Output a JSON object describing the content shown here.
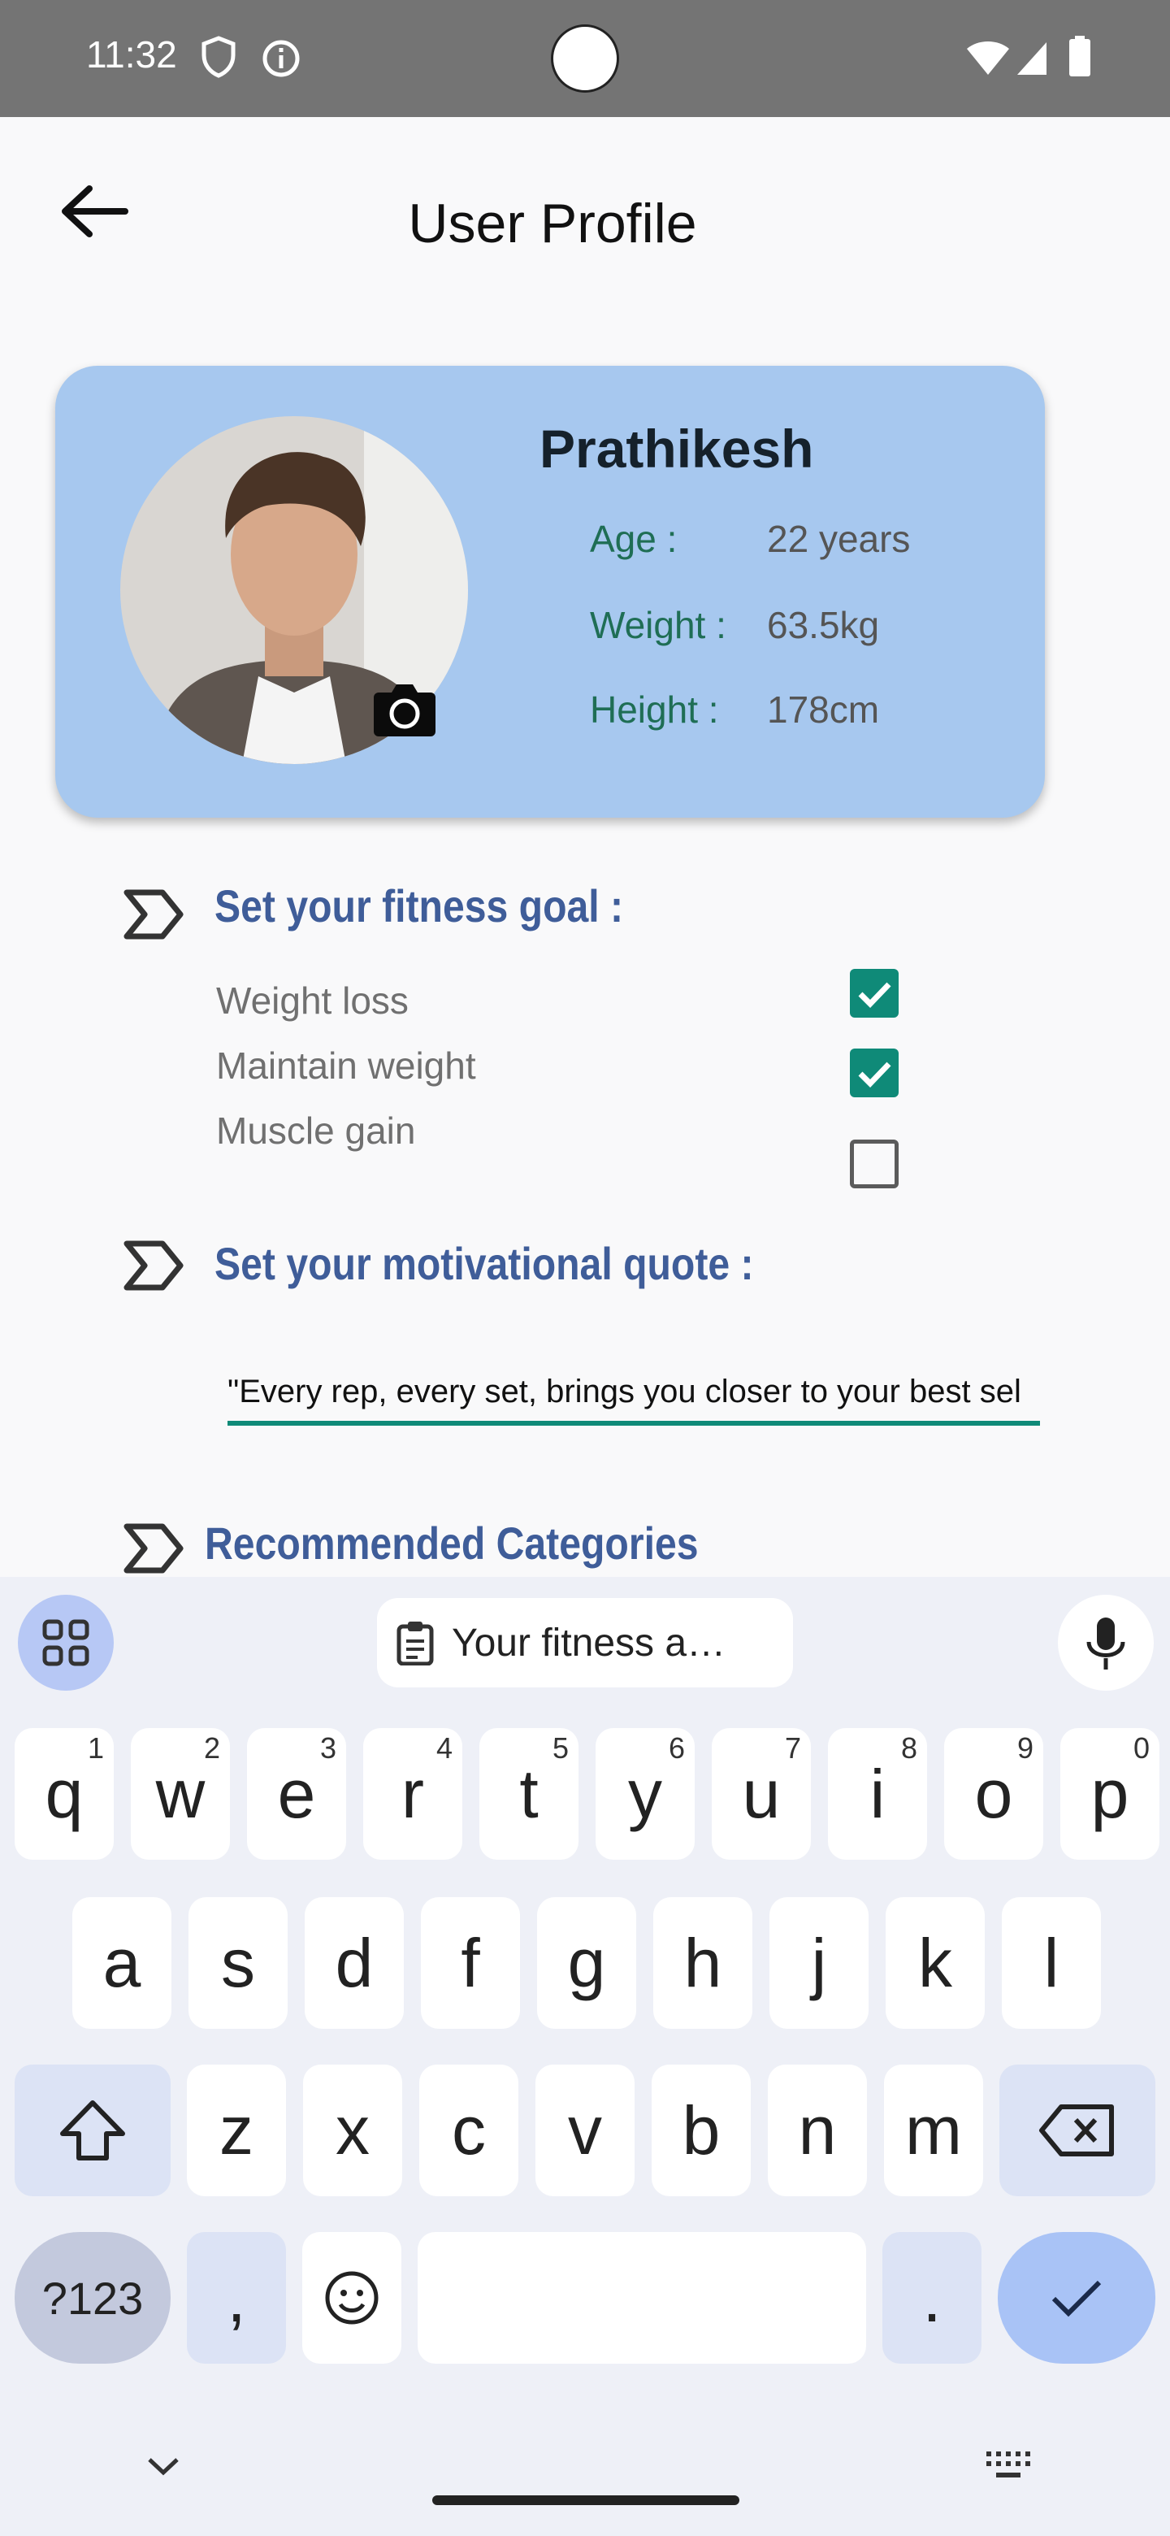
{
  "status_bar": {
    "time": "11:32"
  },
  "header": {
    "title": "User Profile"
  },
  "profile": {
    "name": "Prathikesh",
    "age_label": "Age :",
    "age_value": "22 years",
    "weight_label": "Weight :",
    "weight_value": "63.5kg",
    "height_label": "Height :",
    "height_value": "178cm"
  },
  "goal_section": {
    "title": "Set your fitness goal :",
    "options": [
      {
        "label": "Weight loss",
        "checked": true
      },
      {
        "label": "Maintain weight",
        "checked": true
      },
      {
        "label": "Muscle gain",
        "checked": false
      }
    ]
  },
  "quote_section": {
    "title": "Set your motivational quote :",
    "value": "\"Every rep, every set, brings you closer to your best sel"
  },
  "recommended": {
    "title": "Recommended Categories"
  },
  "keyboard": {
    "suggestion": "Your fitness a…",
    "row1": [
      "q",
      "w",
      "e",
      "r",
      "t",
      "y",
      "u",
      "i",
      "o",
      "p"
    ],
    "row1_hints": [
      "1",
      "2",
      "3",
      "4",
      "5",
      "6",
      "7",
      "8",
      "9",
      "0"
    ],
    "row2": [
      "a",
      "s",
      "d",
      "f",
      "g",
      "h",
      "j",
      "k",
      "l"
    ],
    "row3": [
      "z",
      "x",
      "c",
      "v",
      "b",
      "n",
      "m"
    ],
    "symbols": "?123",
    "comma": ",",
    "period": "."
  }
}
